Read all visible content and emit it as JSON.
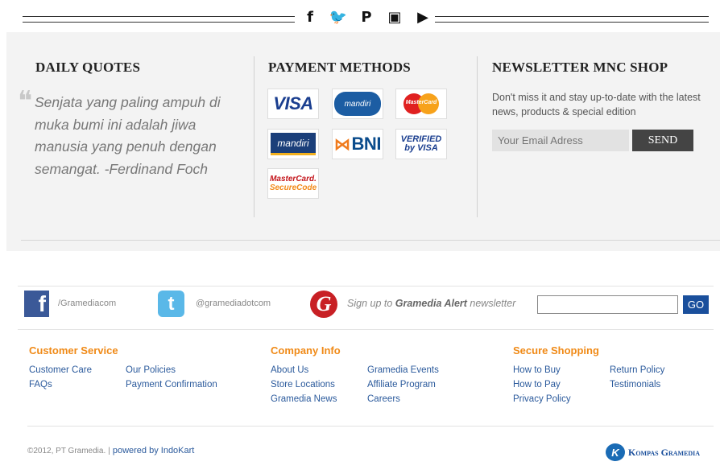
{
  "social_bar": {
    "icons": [
      {
        "name": "facebook-icon",
        "glyph": "f"
      },
      {
        "name": "twitter-icon",
        "glyph": "🐦"
      },
      {
        "name": "pinterest-icon",
        "glyph": "P"
      },
      {
        "name": "instagram-icon",
        "glyph": "▣"
      },
      {
        "name": "youtube-icon",
        "glyph": "▶"
      }
    ]
  },
  "daily_quotes": {
    "title": "DAILY QUOTES",
    "quote": "Senjata yang paling ampuh di muka bumi ini adalah jiwa manusia yang penuh dengan semangat. -Ferdinand Foch"
  },
  "payment": {
    "title": "PAYMENT METHODS",
    "visa": "VISA",
    "mandiri_clickpay": "mandiri",
    "mastercard": "MasterCard",
    "mandiri_debit": "mandiri",
    "bni": "BNI",
    "vbv_top": "VERIFIED",
    "vbv_bottom": "by VISA",
    "mcsc_top": "MasterCard.",
    "mcsc_bottom": "SecureCode"
  },
  "newsletter": {
    "title": "NEWSLETTER MNC SHOP",
    "text": "Don't miss it and stay up-to-date with the latest news, products & special edition",
    "placeholder": "Your Email Adress",
    "send": "SEND"
  },
  "social_strip": {
    "facebook_handle": "/Gramediacom",
    "twitter_handle": "@gramediadotcom",
    "signup_prefix": "Sign up to ",
    "signup_brand": "Gramedia Alert",
    "signup_suffix": " newsletter",
    "go": "GO"
  },
  "footer": {
    "customer_service": {
      "title": "Customer Service",
      "col1": [
        "Customer Care",
        "FAQs"
      ],
      "col2": [
        "Our Policies",
        "Payment Confirmation"
      ]
    },
    "company_info": {
      "title": "Company Info",
      "col1": [
        "About Us",
        "Store Locations",
        "Gramedia News"
      ],
      "col2": [
        "Gramedia Events",
        "Affiliate Program",
        "Careers"
      ]
    },
    "secure_shopping": {
      "title": "Secure Shopping",
      "col1": [
        "How to Buy",
        "How to Pay",
        "Privacy Policy"
      ],
      "col2": [
        "Return Policy",
        "Testimonials"
      ]
    },
    "copyright": "©2012, PT Gramedia.",
    "separator": "|",
    "powered": "powered by IndoKart",
    "brand": "Kompas Gramedia"
  },
  "colors": {
    "accent_orange": "#f08a17",
    "link_blue": "#2b5a9c",
    "panel_grey": "#f3f3f3"
  }
}
